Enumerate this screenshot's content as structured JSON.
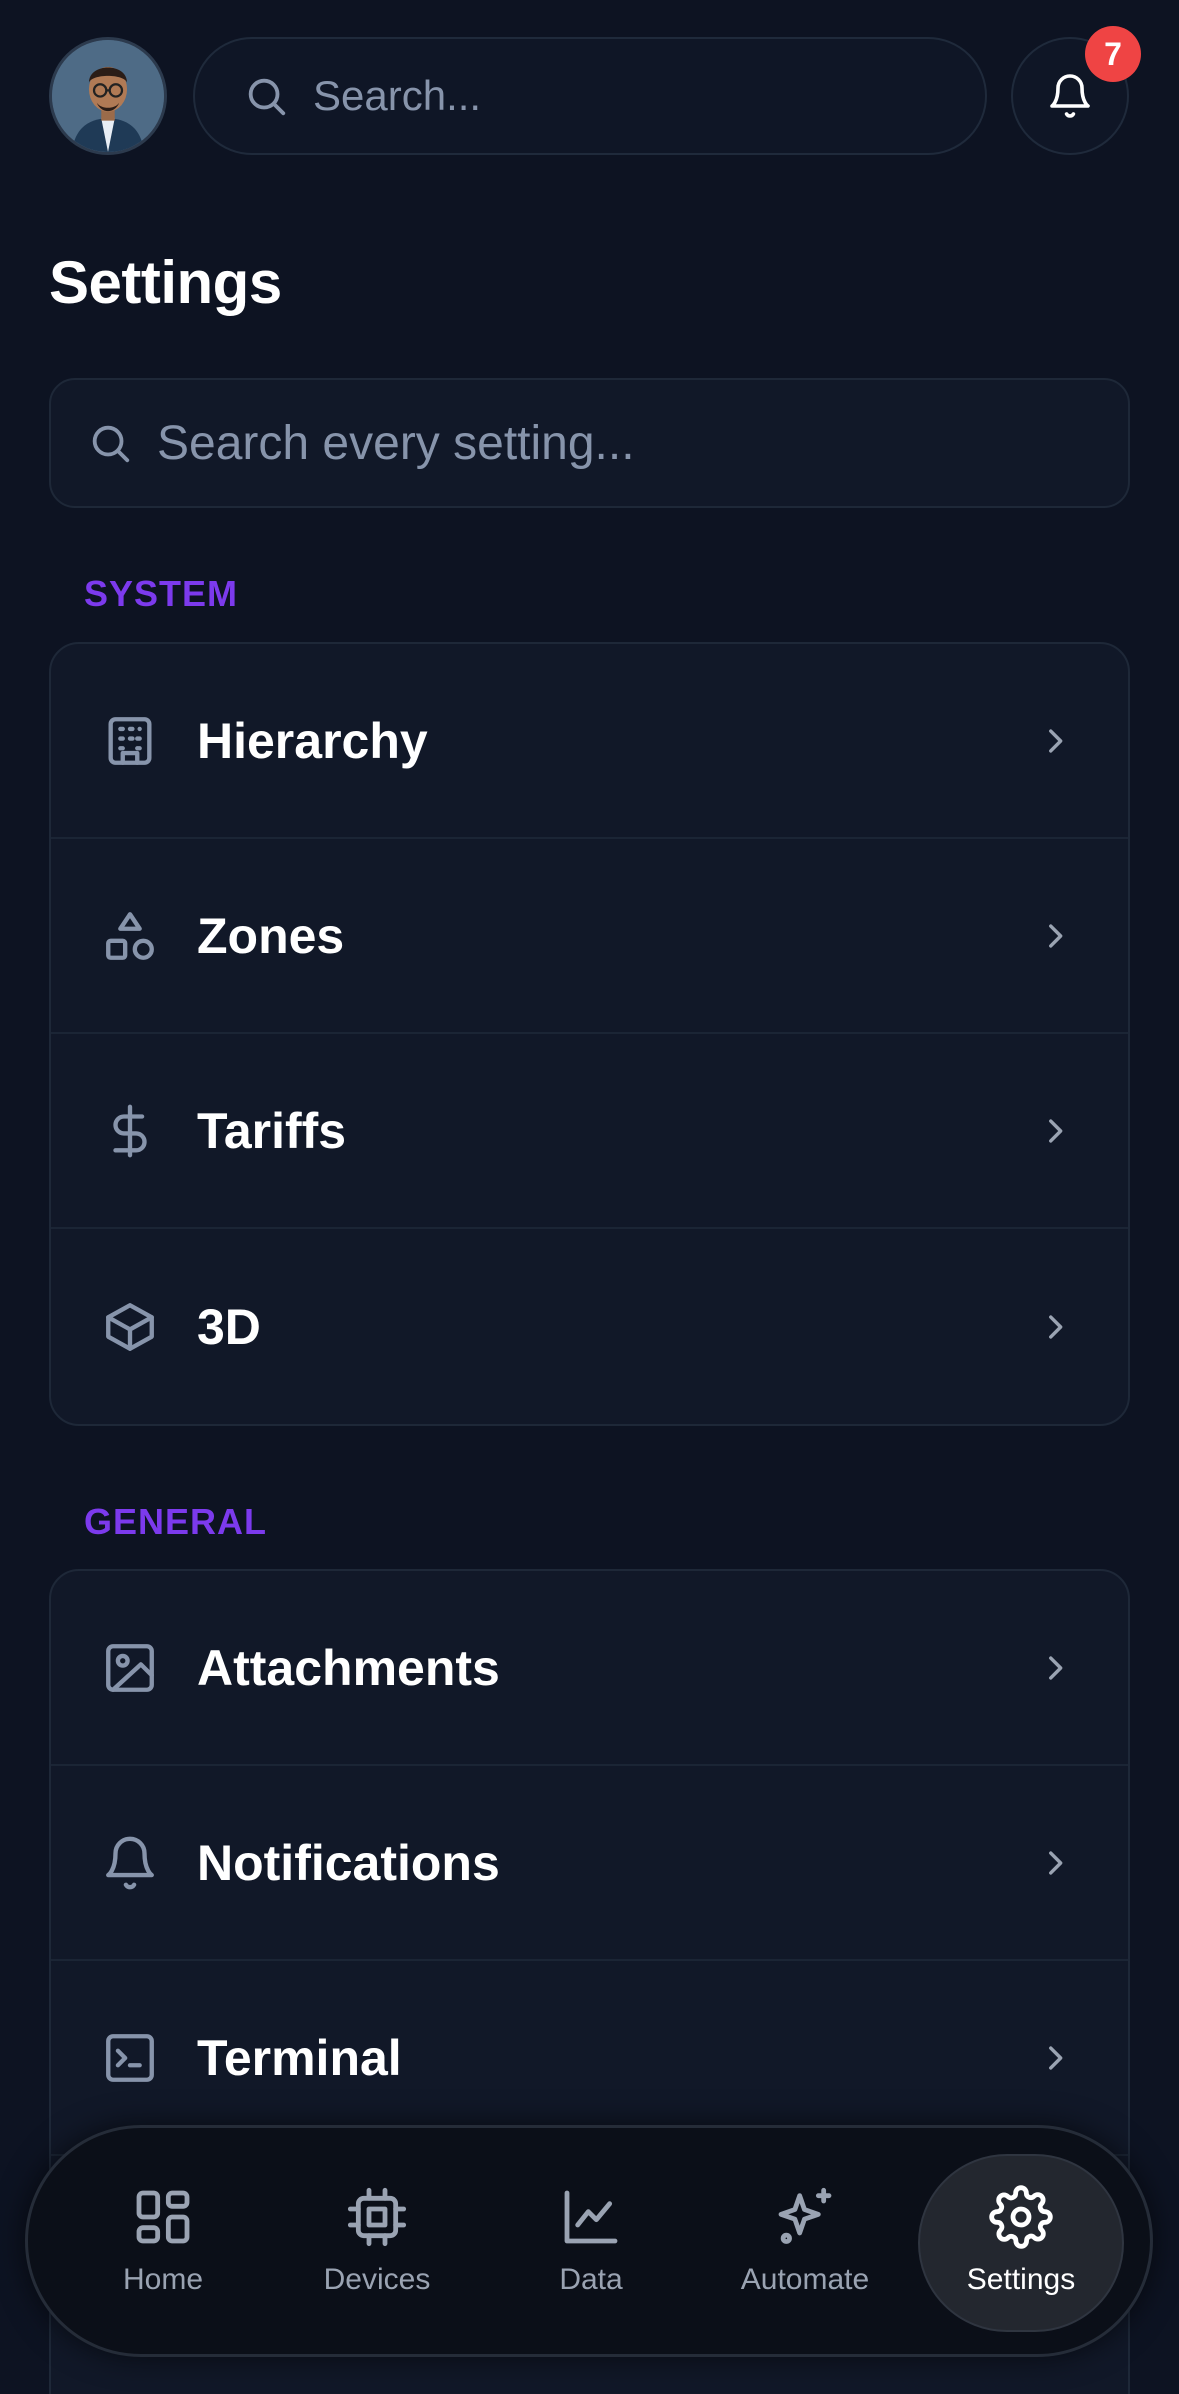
{
  "header": {
    "search_placeholder": "Search...",
    "notification_count": "7"
  },
  "page": {
    "title": "Settings"
  },
  "settings_search": {
    "placeholder": "Search every setting..."
  },
  "sections": [
    {
      "label": "SYSTEM",
      "items": [
        {
          "label": "Hierarchy",
          "icon": "building-icon"
        },
        {
          "label": "Zones",
          "icon": "shapes-icon"
        },
        {
          "label": "Tariffs",
          "icon": "dollar-icon"
        },
        {
          "label": "3D",
          "icon": "cube-icon"
        }
      ]
    },
    {
      "label": "GENERAL",
      "items": [
        {
          "label": "Attachments",
          "icon": "image-icon"
        },
        {
          "label": "Notifications",
          "icon": "bell-icon"
        },
        {
          "label": "Terminal",
          "icon": "terminal-icon"
        }
      ]
    }
  ],
  "bottom_nav": {
    "items": [
      {
        "label": "Home",
        "icon": "grid-icon"
      },
      {
        "label": "Devices",
        "icon": "chip-icon"
      },
      {
        "label": "Data",
        "icon": "chart-line-icon"
      },
      {
        "label": "Automate",
        "icon": "sparkles-icon"
      },
      {
        "label": "Settings",
        "icon": "gear-icon",
        "active": true
      }
    ]
  },
  "colors": {
    "background": "#0d1322",
    "card": "#111828",
    "accent_section": "#7c3aed",
    "badge": "#ef4444",
    "icon_muted": "#8794ab"
  }
}
